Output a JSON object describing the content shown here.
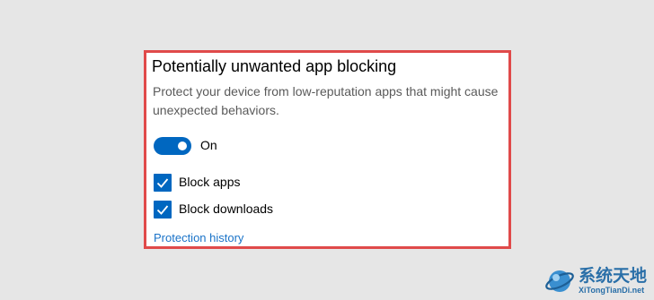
{
  "section": {
    "title": "Potentially unwanted app blocking",
    "description": "Protect your device from low-reputation apps that might cause unexpected behaviors.",
    "toggle": {
      "label": "On",
      "state": true
    },
    "options": [
      {
        "label": "Block apps",
        "checked": true
      },
      {
        "label": "Block downloads",
        "checked": true
      }
    ],
    "link": "Protection history"
  },
  "watermark": {
    "brand_cn": "系统天地",
    "url": "XiTongTianDi.net"
  },
  "colors": {
    "accent": "#0067c0",
    "link": "#1a73c8",
    "highlight_border": "#e04a4a",
    "background": "#e6e6e6"
  }
}
